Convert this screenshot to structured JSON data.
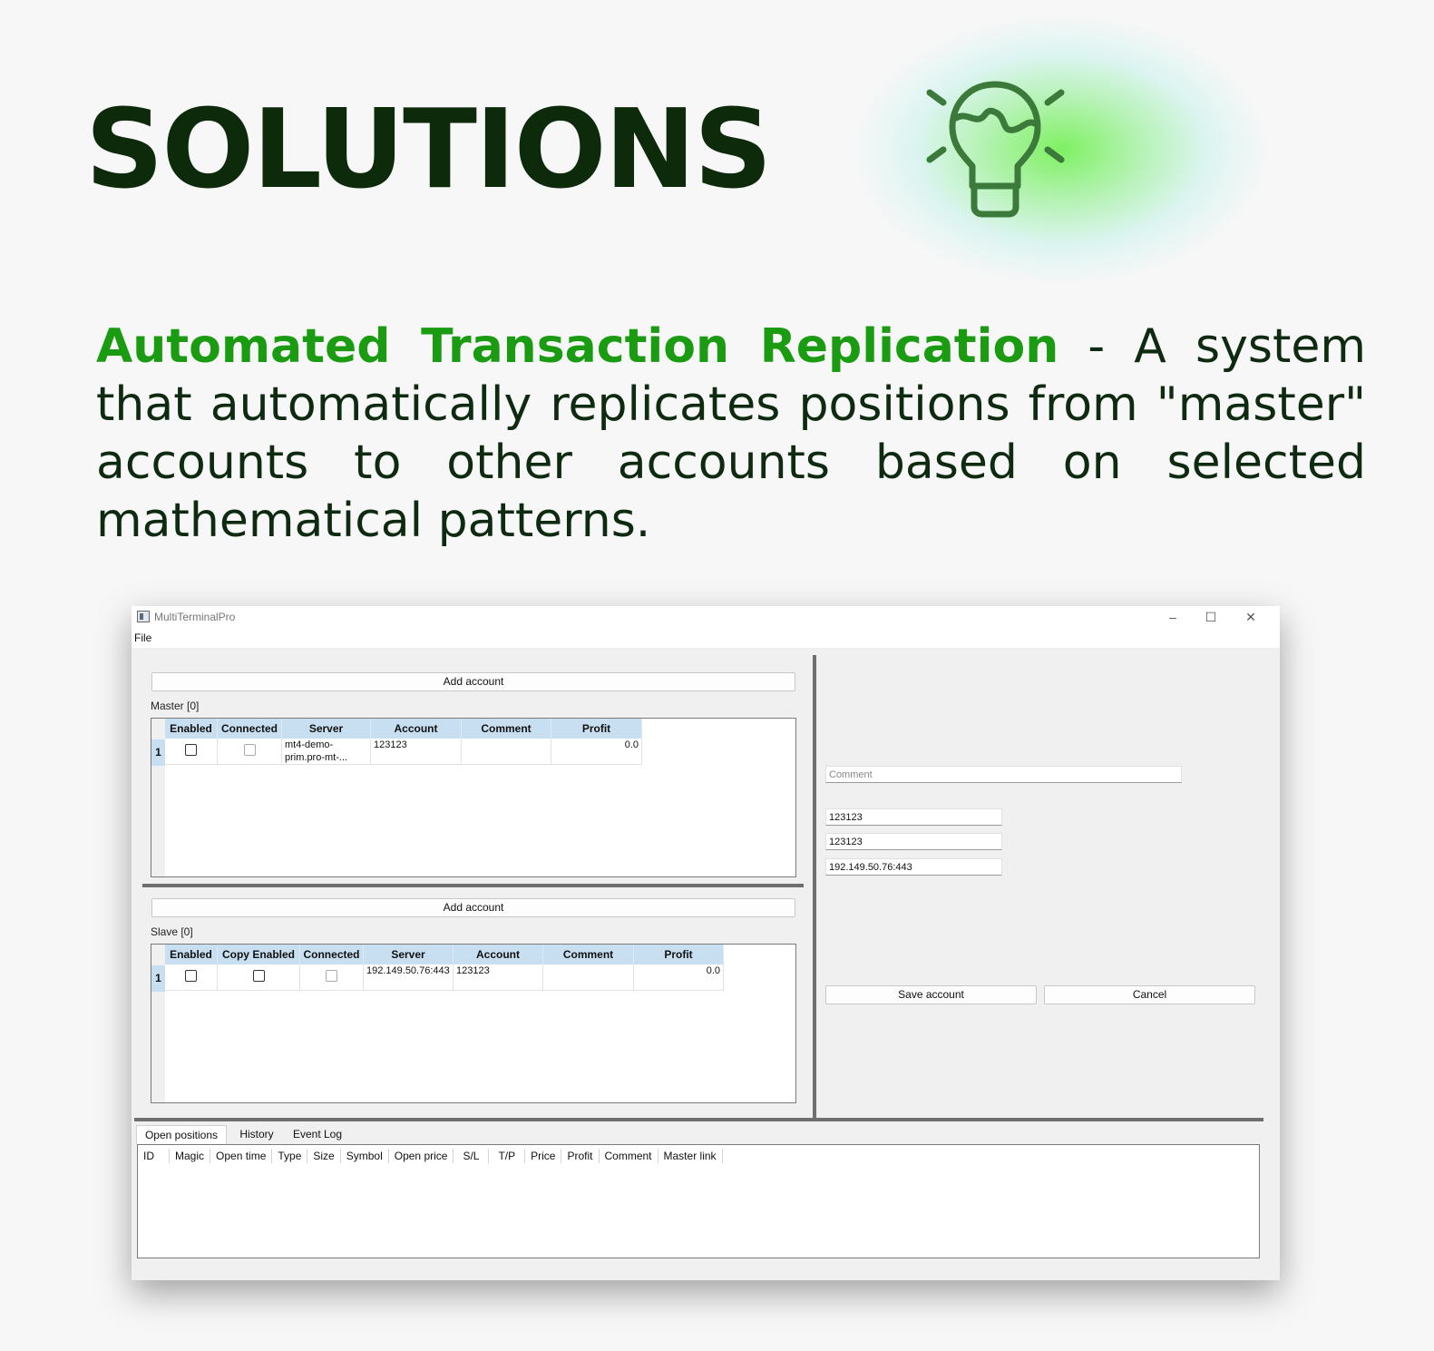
{
  "headline": "SOLUTIONS",
  "description": {
    "highlight": "Automated Transaction Replication",
    "rest": " - A system that automatically replicates positions from \"master\" accounts to other accounts based on selected mathematical patterns."
  },
  "colors": {
    "accent": "#1a9b12",
    "headline": "#0d2a0a",
    "grid_header": "#c7dff1"
  },
  "icons": {
    "illustration": "lightbulb-icon"
  },
  "window": {
    "title": "MultiTerminalPro",
    "controls": {
      "minimize": "–",
      "maximize": "☐",
      "close": "✕"
    },
    "menu": [
      "File"
    ]
  },
  "master": {
    "add_button": "Add account",
    "label": "Master [0]",
    "columns": [
      "Enabled",
      "Connected",
      "Server",
      "Account",
      "Comment",
      "Profit"
    ],
    "rows": [
      {
        "num": "1",
        "enabled": false,
        "connected": false,
        "server": "mt4-demo-prim.pro-mt-...",
        "account": "123123",
        "comment": "",
        "profit": "0.0"
      }
    ]
  },
  "slave": {
    "add_button": "Add account",
    "label": "Slave [0]",
    "columns": [
      "Enabled",
      "Copy Enabled",
      "Connected",
      "Server",
      "Account",
      "Comment",
      "Profit"
    ],
    "rows": [
      {
        "num": "1",
        "enabled": false,
        "copy_enabled": false,
        "connected": false,
        "server": "192.149.50.76:443",
        "account": "123123",
        "comment": "",
        "profit": "0.0"
      }
    ]
  },
  "form": {
    "comment_placeholder": "Comment",
    "field1": "123123",
    "field2": "123123",
    "field3": "192.149.50.76:443",
    "save_button": "Save account",
    "cancel_button": "Cancel"
  },
  "bottom_tabs": [
    "Open positions",
    "History",
    "Event Log"
  ],
  "positions_columns": [
    "ID",
    "Magic",
    "Open time",
    "Type",
    "Size",
    "Symbol",
    "Open price",
    "S/L",
    "T/P",
    "Price",
    "Profit",
    "Comment",
    "Master link"
  ]
}
